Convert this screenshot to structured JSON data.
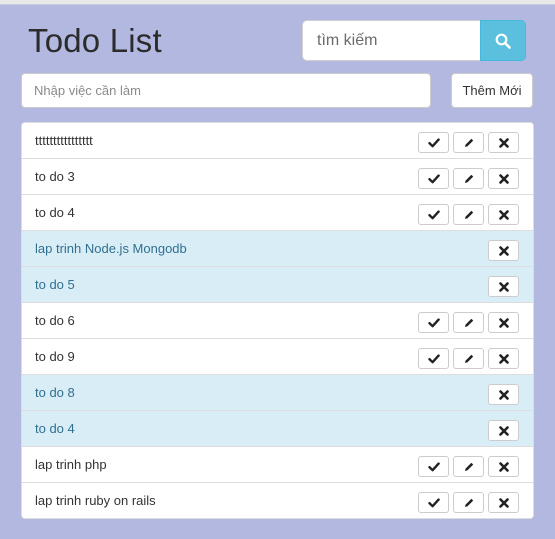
{
  "app": {
    "title": "Todo List"
  },
  "search": {
    "placeholder": "tìm kiếm",
    "icon": "search-icon",
    "button_color": "#5bc0de"
  },
  "add_form": {
    "placeholder": "Nhập việc cần làm",
    "button_label": "Thêm Mới"
  },
  "colors": {
    "background": "#b3b8e0",
    "done_row": "#d9edf7",
    "done_text": "#31708f"
  },
  "todos": [
    {
      "text": "tttttttttttttttt",
      "done": false
    },
    {
      "text": "to do 3",
      "done": false
    },
    {
      "text": "to do 4",
      "done": false
    },
    {
      "text": "lap trinh Node.js Mongodb",
      "done": true
    },
    {
      "text": "to do 5",
      "done": true
    },
    {
      "text": "to do 6",
      "done": false
    },
    {
      "text": "to do 9",
      "done": false
    },
    {
      "text": "to do 8",
      "done": true
    },
    {
      "text": "to do 4",
      "done": true
    },
    {
      "text": "lap trinh php",
      "done": false
    },
    {
      "text": "lap trinh ruby on rails",
      "done": false
    }
  ],
  "row_icons": {
    "complete": "check-icon",
    "edit": "pencil-icon",
    "delete": "close-icon"
  }
}
